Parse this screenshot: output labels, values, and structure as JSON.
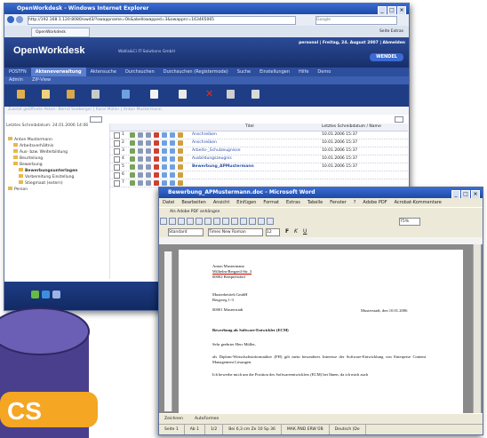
{
  "ie": {
    "title": "OpenWorkdesk - Windows Internet Explorer",
    "address": "http://192.168.1.120:8080/owd3/?owappname=Ok&abellowapped=3&owappnr=163465065",
    "search_placeholder": "Google",
    "tab": "OpenWorkdesk",
    "right_tools": "Seite  Extras"
  },
  "ow": {
    "logo": "OpenWorkdesk",
    "vendor": "Wallis&Ci IT-Solutions GmbH",
    "user_info": "personal | Freitag, 24. August 2007 | Abmelden",
    "brand": "WENDEL",
    "nav": [
      "POSTFN",
      "Akteneverwaltung",
      "Aktensuche",
      "Durchsuchen",
      "Durchsuchen (Registermode)",
      "Suche",
      "Einstellungen",
      "Hilfe",
      "Demo"
    ],
    "nav_active": 1,
    "subnav": [
      "Admin",
      "ZIP-View"
    ],
    "crumb": "Zuletzt geöffnete Akten:  Bernd Seeberger | Karol Müller | Anton Mustermann",
    "tree_header": "Letztes Schreibdatum: 24.01.2006 14:06",
    "tree": [
      "Anton Mustermann",
      "Arbeitsverhältnis",
      "Aus- bzw. Weiterbildung",
      "Beurteilung",
      "Bewerbung",
      "Bewerbungsunterlagen",
      "Vorbereitung Einstellung",
      "Stiegmaat (extern)",
      "Person"
    ],
    "grid_headers": [
      "Titel",
      "Letztes Schreibdatum / Name"
    ],
    "rows": [
      {
        "n": "1",
        "title": "Anschreiben",
        "date": "10.01.2006 15:37"
      },
      {
        "n": "2",
        "title": "Anschreiben",
        "date": "10.01.2006 15:37"
      },
      {
        "n": "3",
        "title": "Arbeits-_Schulzeugnisse",
        "date": "10.01.2006 15:37"
      },
      {
        "n": "4",
        "title": "Ausbildungszeugnis",
        "date": "10.01.2006 15:37"
      },
      {
        "n": "5",
        "title": "Bewerbung_APMustermann",
        "date": "10.01.2006 15:37"
      },
      {
        "n": "6",
        "title": "",
        "date": ""
      },
      {
        "n": "7",
        "title": "",
        "date": ""
      }
    ]
  },
  "word": {
    "title": "Bewerbung_APMustermann.doc - Microsoft Word",
    "menu": [
      "Datei",
      "Bearbeiten",
      "Ansicht",
      "Einfügen",
      "Format",
      "Extras",
      "Tabelle",
      "Fenster",
      "?",
      "Adobe PDF",
      "Acrobat-Kommentare"
    ],
    "pdf_button": "Als Adobe PDF anhängen",
    "style": "Standard",
    "font": "Times New Roman",
    "size": "12",
    "zoom": "75%",
    "draw_label": "Zeichnen",
    "autoformen": "AutoFormen",
    "status": [
      "Seite  1",
      "Ab  1",
      "1/2",
      "Bei 6,3 cm  Ze 10  Sp 36",
      "MAK  ÄND  ERW  ÜB",
      "Deutsch (De"
    ],
    "doc": {
      "sender": [
        "Anton Mustermann",
        "Wilhelm-Bergzeil-Str. 3",
        "00002 Beispielsdorf"
      ],
      "recipient": [
        "Musterbetrieb GmbH",
        "Bergweg 1-3",
        "00001 Musterstadt"
      ],
      "date_line": "Musterstadt, den 10.01.2006",
      "subject": "Bewerbung als Software-Entwickler (ECM)",
      "greeting": "Sehr geehrter Herr Müller,",
      "para1": "als Diplom-Wirtschaftsinformatiker (FH) gilt mein besonderes Interesse der Software-Entwicklung von Enterprise Content Management Lösungen.",
      "para2": "Ich bewerbe mich um die Position des Softwareentwicklers (ECM) bei Ihnen, da ich mich auch"
    }
  },
  "logo_fragment": "CS",
  "colors": {
    "ow_blue": "#1f3d85",
    "folder": "#e8b84a",
    "logo_orange": "#f5a623",
    "logo_purple": "#4a3f8c"
  }
}
